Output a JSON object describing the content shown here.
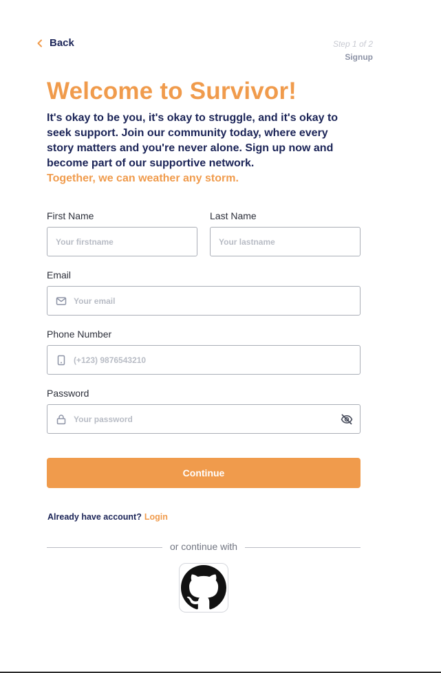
{
  "header": {
    "back_label": "Back",
    "step_text": "Step 1 of 2",
    "step_name": "Signup"
  },
  "hero": {
    "title": "Welcome to Survivor!",
    "intro": "It's okay to be you, it's okay to struggle, and it's okay to seek support. Join our community today, where every story matters and you're never alone. Sign up now and become part of our supportive network.",
    "tagline": "Together, we can weather any storm."
  },
  "form": {
    "first_name": {
      "label": "First Name",
      "placeholder": "Your firstname"
    },
    "last_name": {
      "label": "Last Name",
      "placeholder": "Your lastname"
    },
    "email": {
      "label": "Email",
      "placeholder": "Your email",
      "icon": "mail-icon"
    },
    "phone": {
      "label": "Phone Number",
      "placeholder": "(+123) 9876543210",
      "icon": "phone-icon"
    },
    "password": {
      "label": "Password",
      "placeholder": "Your password",
      "icon": "lock-icon",
      "toggle_icon": "eye-off-icon"
    },
    "submit_label": "Continue"
  },
  "account": {
    "prompt": "Already have account?",
    "login_label": "Login"
  },
  "social": {
    "divider_text": "or continue with",
    "providers": [
      {
        "name": "github-icon"
      }
    ]
  },
  "colors": {
    "accent": "#f09b4c",
    "navy": "#1b2457",
    "border": "#a9adb6",
    "placeholder": "#b8bcc5"
  }
}
